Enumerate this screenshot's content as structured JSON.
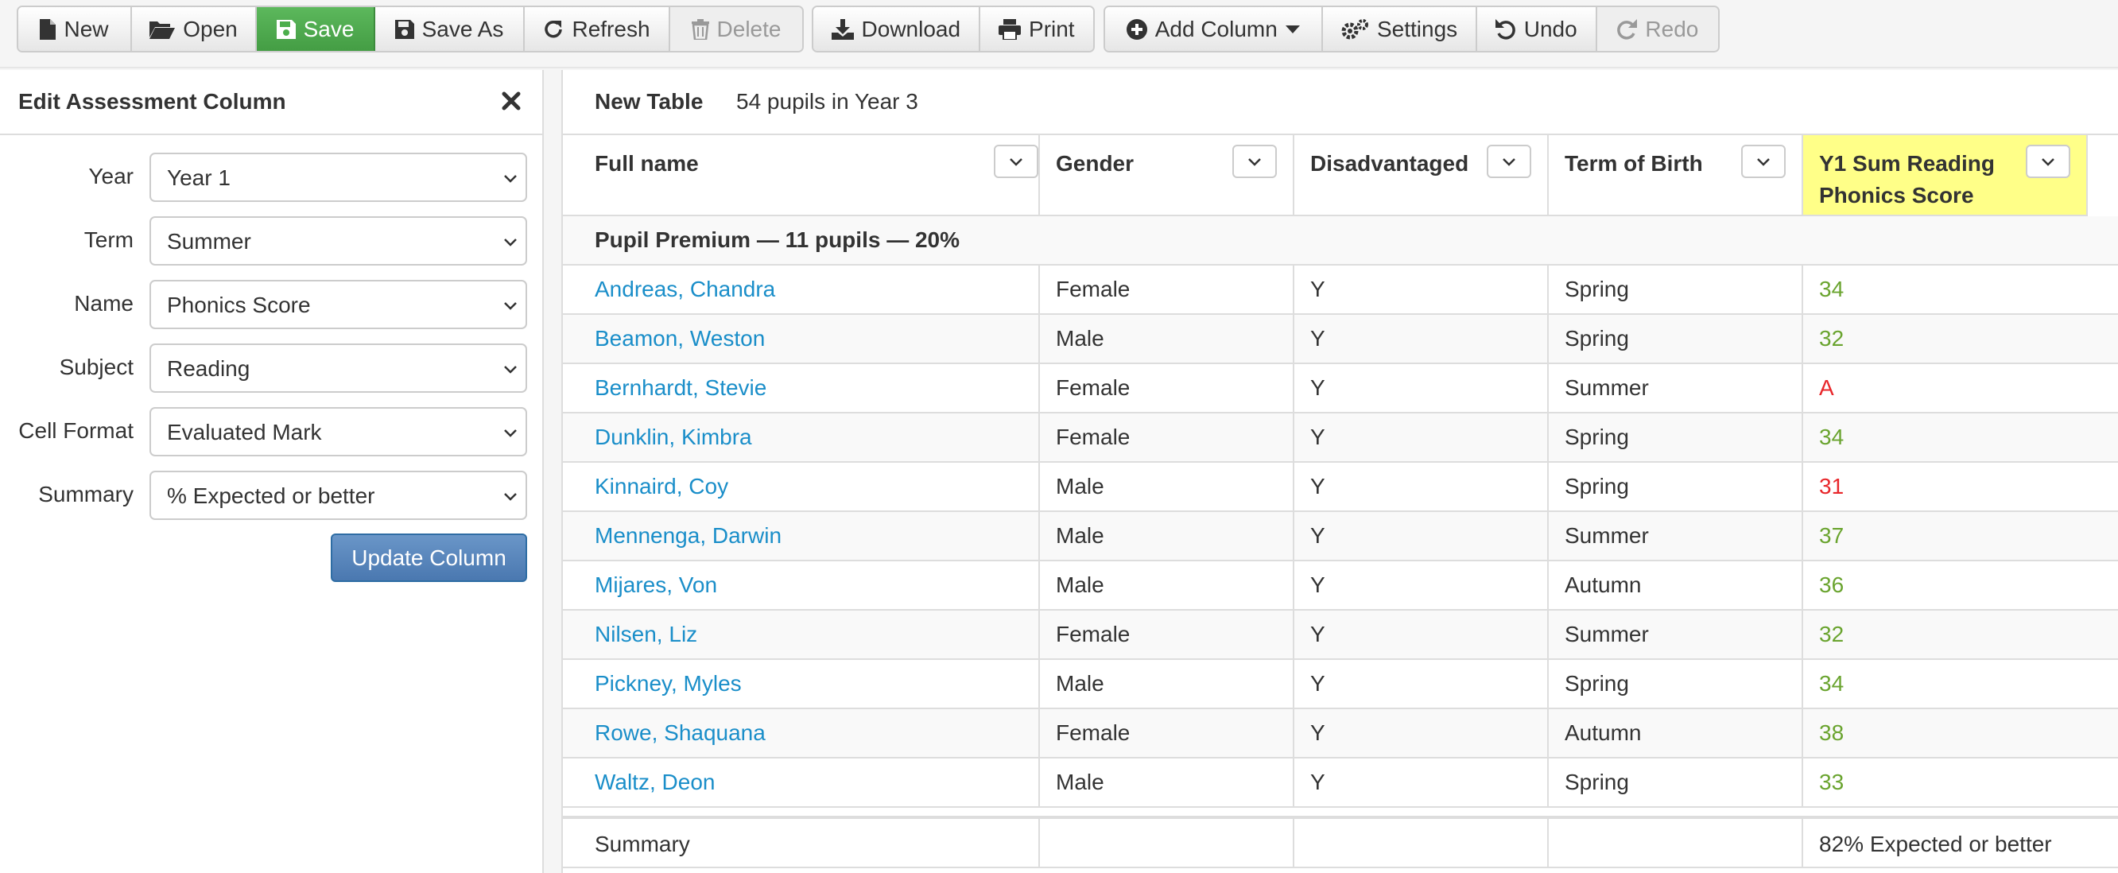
{
  "toolbar": {
    "new": "New",
    "open": "Open",
    "save": "Save",
    "save_as": "Save As",
    "refresh": "Refresh",
    "delete": "Delete",
    "download": "Download",
    "print": "Print",
    "add_column": "Add Column",
    "settings": "Settings",
    "undo": "Undo",
    "redo": "Redo"
  },
  "panel": {
    "title": "Edit Assessment Column",
    "fields": [
      {
        "label": "Year",
        "value": "Year 1"
      },
      {
        "label": "Term",
        "value": "Summer"
      },
      {
        "label": "Name",
        "value": "Phonics Score"
      },
      {
        "label": "Subject",
        "value": "Reading"
      },
      {
        "label": "Cell Format",
        "value": "Evaluated Mark"
      },
      {
        "label": "Summary",
        "value": "% Expected or better"
      }
    ],
    "update_button": "Update Column"
  },
  "table": {
    "name": "New Table",
    "count": "54 pupils in Year 3",
    "columns": [
      {
        "title": "Full name"
      },
      {
        "title": "Gender"
      },
      {
        "title": "Disadvantaged"
      },
      {
        "title": "Term of Birth"
      },
      {
        "title_line1": "Y1 Sum Reading",
        "title_line2": "Phonics Score"
      }
    ],
    "group_label": "Pupil Premium — 11 pupils — 20%",
    "rows": [
      {
        "name": "Andreas, Chandra",
        "gender": "Female",
        "disadvantaged": "Y",
        "term": "Spring",
        "score": "34",
        "status": "green"
      },
      {
        "name": "Beamon, Weston",
        "gender": "Male",
        "disadvantaged": "Y",
        "term": "Spring",
        "score": "32",
        "status": "green"
      },
      {
        "name": "Bernhardt, Stevie",
        "gender": "Female",
        "disadvantaged": "Y",
        "term": "Summer",
        "score": "A",
        "status": "red"
      },
      {
        "name": "Dunklin, Kimbra",
        "gender": "Female",
        "disadvantaged": "Y",
        "term": "Spring",
        "score": "34",
        "status": "green"
      },
      {
        "name": "Kinnaird, Coy",
        "gender": "Male",
        "disadvantaged": "Y",
        "term": "Spring",
        "score": "31",
        "status": "red"
      },
      {
        "name": "Mennenga, Darwin",
        "gender": "Male",
        "disadvantaged": "Y",
        "term": "Summer",
        "score": "37",
        "status": "green"
      },
      {
        "name": "Mijares, Von",
        "gender": "Male",
        "disadvantaged": "Y",
        "term": "Autumn",
        "score": "36",
        "status": "green"
      },
      {
        "name": "Nilsen, Liz",
        "gender": "Female",
        "disadvantaged": "Y",
        "term": "Summer",
        "score": "32",
        "status": "green"
      },
      {
        "name": "Pickney, Myles",
        "gender": "Male",
        "disadvantaged": "Y",
        "term": "Spring",
        "score": "34",
        "status": "green"
      },
      {
        "name": "Rowe, Shaquana",
        "gender": "Female",
        "disadvantaged": "Y",
        "term": "Autumn",
        "score": "38",
        "status": "green"
      },
      {
        "name": "Waltz, Deon",
        "gender": "Male",
        "disadvantaged": "Y",
        "term": "Spring",
        "score": "33",
        "status": "green"
      }
    ],
    "summary_label": "Summary",
    "summary_value": "82% Expected or better"
  },
  "colors": {
    "save_green": "#5cb85c",
    "link_blue": "#1a8ec9",
    "score_green": "#6aa42f",
    "score_red": "#e8262a",
    "highlight_yellow": "#ffff88",
    "update_blue": "#4a78b0"
  }
}
